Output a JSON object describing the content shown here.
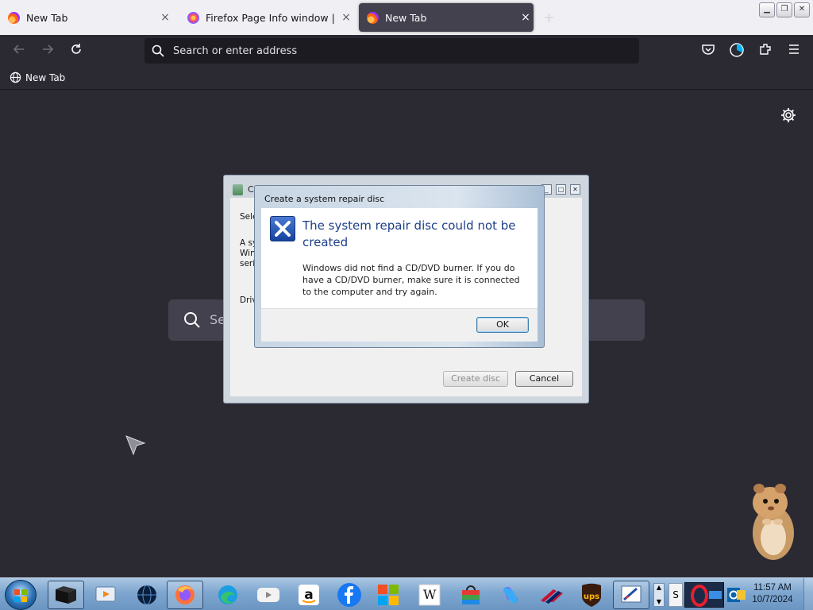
{
  "tabs": [
    {
      "title": "New Tab",
      "close": "×"
    },
    {
      "title": "Firefox Page Info window | Firef",
      "close": "×"
    },
    {
      "title": "New Tab",
      "close": "×"
    }
  ],
  "toolbar": {
    "address_placeholder": "Search or enter address"
  },
  "bookmarks": [
    {
      "label": "New Tab"
    }
  ],
  "newtab": {
    "search_text": "Se"
  },
  "background_dialog": {
    "title": "C",
    "line1": "Sele",
    "line2a": "A sy",
    "line2b": "Win",
    "line2c": "seri",
    "line3": "Driv",
    "create_button": "Create disc",
    "cancel_button": "Cancel"
  },
  "error_dialog": {
    "title": "Create a system repair disc",
    "heading": "The system repair disc could not be created",
    "message": "Windows did not find a CD/DVD burner. If you do have a CD/DVD burner, make sure it is connected to the computer and try again.",
    "ok_button": "OK"
  },
  "taskbar": {
    "time": "11:57 AM",
    "date": "10/7/2024",
    "tray_letter": "S",
    "apps": [
      "media-player",
      "tv",
      "browser-globe",
      "firefox",
      "edge",
      "youtube",
      "amazon",
      "facebook",
      "microsoft-store",
      "wikipedia",
      "shopping-bag",
      "copilot",
      "bank-of-america",
      "ups",
      "paint"
    ],
    "wiki_letter": "W"
  },
  "colors": {
    "firefox_bg": "#2b2a33",
    "tabstrip": "#f0f0f4",
    "dialog_heading": "#1e3f8a"
  }
}
